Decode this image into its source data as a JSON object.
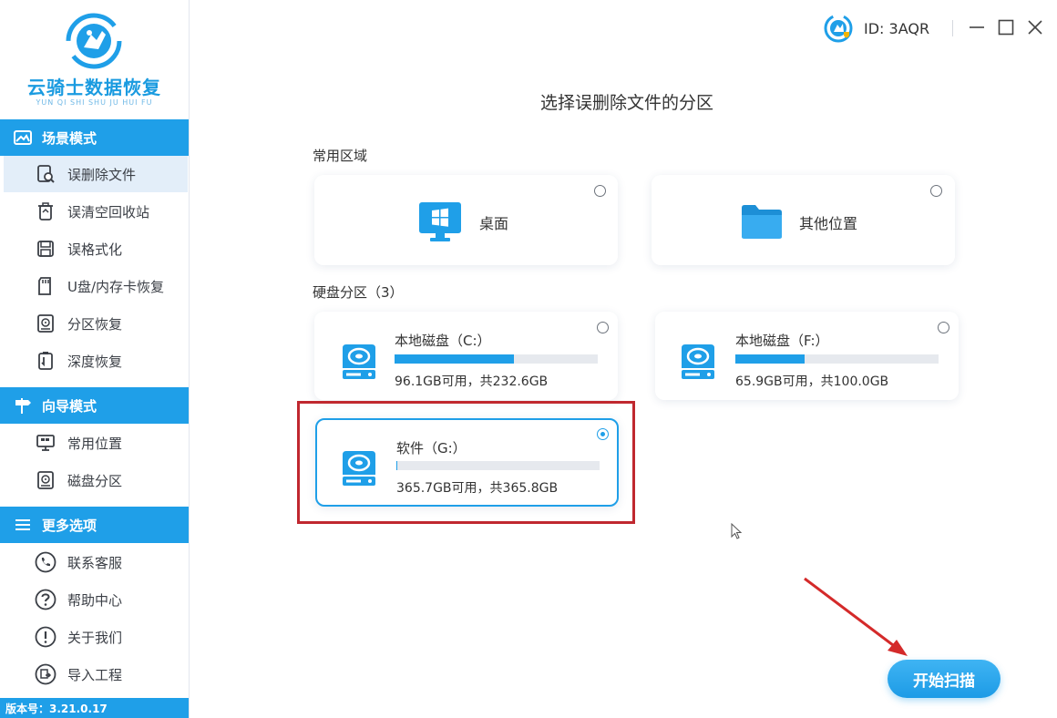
{
  "app": {
    "name": "云骑士数据恢复",
    "name_pinyin": "YUN QI SHI SHU JU HUI FU",
    "version": "版本号：3.21.0.17",
    "user_id": "ID: 3AQR",
    "accent_color": "#1f9fe8",
    "highlight_color": "#c0282f"
  },
  "sidebar": {
    "sections": [
      {
        "title": "场景模式",
        "icon": "scene-icon",
        "items": [
          {
            "label": "误删除文件",
            "icon": "file-search-icon",
            "active": true
          },
          {
            "label": "误清空回收站",
            "icon": "recycle-bin-icon",
            "active": false
          },
          {
            "label": "误格式化",
            "icon": "format-disk-icon",
            "active": false
          },
          {
            "label": "U盘/内存卡恢复",
            "icon": "usb-card-icon",
            "active": false
          },
          {
            "label": "分区恢复",
            "icon": "partition-icon",
            "active": false
          },
          {
            "label": "深度恢复",
            "icon": "deep-recovery-icon",
            "active": false
          }
        ]
      },
      {
        "title": "向导模式",
        "icon": "signpost-icon",
        "items": [
          {
            "label": "常用位置",
            "icon": "monitor-icon",
            "active": false
          },
          {
            "label": "磁盘分区",
            "icon": "disk-partition-icon",
            "active": false
          }
        ]
      },
      {
        "title": "更多选项",
        "icon": "menu-icon",
        "items": [
          {
            "label": "联系客服",
            "icon": "phone-icon",
            "active": false
          },
          {
            "label": "帮助中心",
            "icon": "help-icon",
            "active": false
          },
          {
            "label": "关于我们",
            "icon": "info-icon",
            "active": false
          },
          {
            "label": "导入工程",
            "icon": "import-icon",
            "active": false
          }
        ]
      }
    ]
  },
  "main": {
    "title": "选择误删除文件的分区",
    "common_area": {
      "label": "常用区域",
      "items": [
        {
          "label": "桌面",
          "icon": "desktop-windows-icon",
          "selected": false
        },
        {
          "label": "其他位置",
          "icon": "folder-icon",
          "selected": false
        }
      ]
    },
    "disks": {
      "label": "硬盘分区（3）",
      "items": [
        {
          "name": "本地磁盘（C:）",
          "free": "96.1GB可用，共232.6GB",
          "used_fraction": 0.587,
          "selected": false
        },
        {
          "name": "本地磁盘（F:）",
          "free": "65.9GB可用，共100.0GB",
          "used_fraction": 0.341,
          "selected": false
        },
        {
          "name": "软件（G:）",
          "free": "365.7GB可用，共365.8GB",
          "used_fraction": 0.0003,
          "selected": true
        }
      ]
    },
    "scan_button": "开始扫描"
  }
}
